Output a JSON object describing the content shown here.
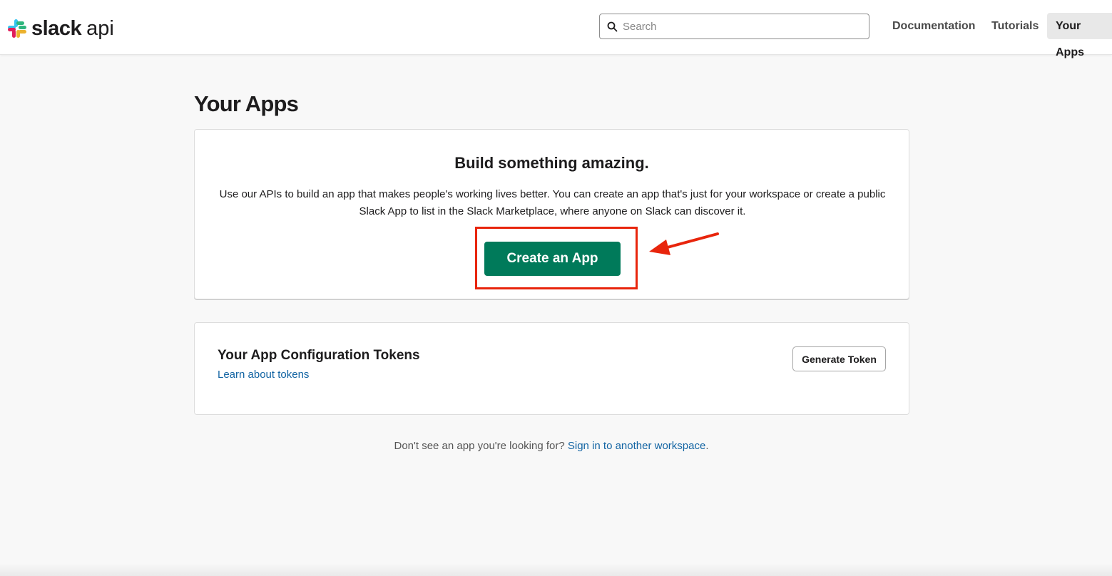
{
  "header": {
    "logo_text": "slack",
    "logo_suffix": "api",
    "search_placeholder": "Search",
    "nav": {
      "documentation": "Documentation",
      "tutorials": "Tutorials",
      "your_apps": "Your Apps"
    }
  },
  "page": {
    "title": "Your Apps"
  },
  "build_card": {
    "title": "Build something amazing.",
    "description": "Use our APIs to build an app that makes people's working lives better. You can create an app that's just for your workspace or create a public Slack App to list in the Slack Marketplace, where anyone on Slack can discover it.",
    "create_button": "Create an App",
    "annotation": {
      "highlight_color": "#e8250c",
      "arrow_color": "#e8250c"
    }
  },
  "tokens_card": {
    "title": "Your App Configuration Tokens",
    "learn_link": "Learn about tokens",
    "generate_button": "Generate Token"
  },
  "footer": {
    "prefix": "Don't see an app you're looking for? ",
    "link": "Sign in to another workspace",
    "suffix": "."
  },
  "colors": {
    "primary_button": "#007a5a",
    "link": "#1264a3",
    "page_background": "#f8f8f8"
  },
  "icons": {
    "logo": "slack-hash-logo-icon",
    "search": "search-icon",
    "arrow": "arrow-left-annotation-icon"
  }
}
